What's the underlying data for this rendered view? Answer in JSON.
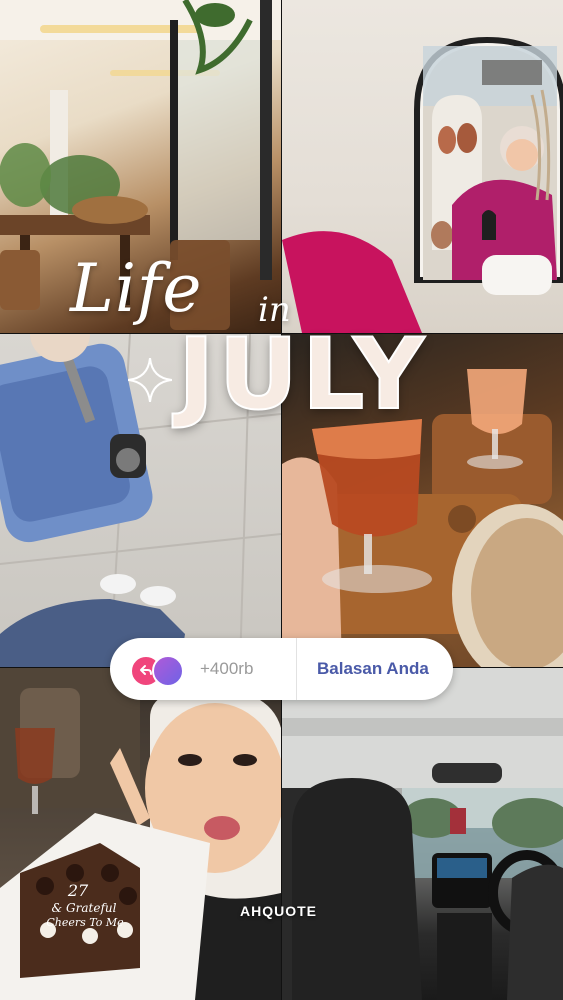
{
  "story": {
    "title_line1": "Life",
    "title_line2": "in",
    "title_month": "JULY",
    "watermark": "AHQUOTE"
  },
  "photos": [
    {
      "name": "photo-restaurant-interior"
    },
    {
      "name": "photo-arch-mirror-selfie"
    },
    {
      "name": "photo-suitcase-on-floor"
    },
    {
      "name": "photo-drinks-on-table"
    },
    {
      "name": "photo-cake-selfie"
    },
    {
      "name": "photo-car-interior"
    }
  ],
  "cake_text": [
    "27",
    "& Grateful",
    "Cheers To Me"
  ],
  "reply_bar": {
    "avatar_icon": "reply-arrow-icon",
    "count": "+400rb",
    "label": "Balasan Anda"
  },
  "colors": {
    "pill_bg": "#ffffff",
    "reply_label": "#4a5aa8",
    "count_text": "#9a9a9a",
    "avatar_pink": "#f0457c"
  }
}
